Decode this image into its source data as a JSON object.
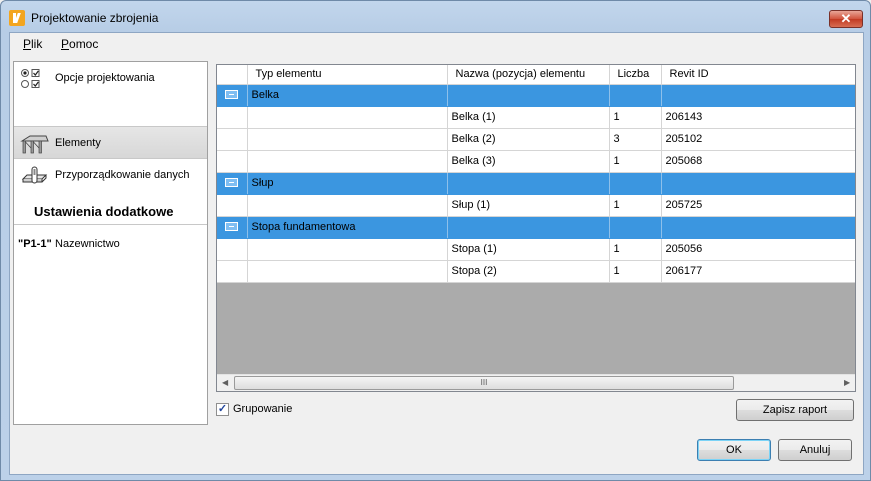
{
  "window": {
    "title": "Projektowanie zbrojenia",
    "close_glyph": "✕"
  },
  "menu": {
    "items": [
      {
        "label": "Plik",
        "mnemonic": "P",
        "rest": "lik"
      },
      {
        "label": "Pomoc",
        "mnemonic": "P",
        "rest": "omoc"
      }
    ]
  },
  "sidebar": {
    "items": [
      {
        "label": "Opcje projektowania",
        "icon": "options-radio-checkbox-icon",
        "selected": false
      },
      {
        "label": "Elementy",
        "icon": "structure-elements-icon",
        "selected": true
      },
      {
        "label": "Przyporządkowanie danych",
        "icon": "data-mapping-icon",
        "selected": false
      }
    ],
    "section_title": "Ustawienia dodatkowe",
    "extra_items": [
      {
        "icon_text": "\"P1-1\"",
        "label": "Nazewnictwo"
      }
    ]
  },
  "grid": {
    "columns": [
      "Typ elementu",
      "Nazwa (pozycja) elementu",
      "Liczba",
      "Revit ID"
    ],
    "groups": [
      {
        "name": "Belka",
        "rows": [
          {
            "name": "Belka (1)",
            "count": "1",
            "revit_id": "206143"
          },
          {
            "name": "Belka (2)",
            "count": "3",
            "revit_id": "205102"
          },
          {
            "name": "Belka (3)",
            "count": "1",
            "revit_id": "205068"
          }
        ]
      },
      {
        "name": "Słup",
        "rows": [
          {
            "name": "Słup (1)",
            "count": "1",
            "revit_id": "205725"
          }
        ]
      },
      {
        "name": "Stopa fundamentowa",
        "rows": [
          {
            "name": "Stopa (1)",
            "count": "1",
            "revit_id": "205056"
          },
          {
            "name": "Stopa (2)",
            "count": "1",
            "revit_id": "206177"
          }
        ]
      }
    ],
    "colors": {
      "group_row": "#3b96e0",
      "empty_area": "#ababab"
    },
    "scrollbar": {
      "left_arrow": "◀",
      "right_arrow": "▶",
      "thumb_grip": "III"
    }
  },
  "grouping": {
    "label": "Grupowanie",
    "checked": true,
    "check_glyph": "✓"
  },
  "buttons": {
    "save_report": "Zapisz raport",
    "ok": "OK",
    "cancel": "Anuluj"
  }
}
